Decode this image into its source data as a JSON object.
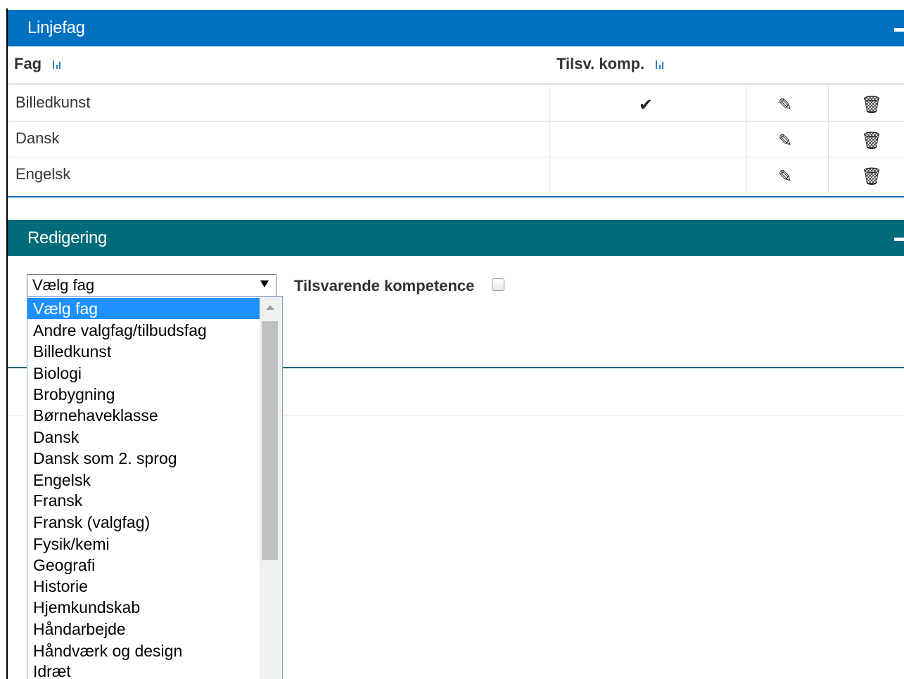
{
  "linjefag": {
    "title": "Linjefag",
    "col_fag": "Fag",
    "col_tilsv": "Tilsv. komp.",
    "rows": [
      {
        "fag": "Billedkunst",
        "tilsv": true
      },
      {
        "fag": "Dansk",
        "tilsv": false
      },
      {
        "fag": "Engelsk",
        "tilsv": false
      }
    ]
  },
  "redigering": {
    "title": "Redigering",
    "select_value": "Vælg fag",
    "checkbox_label": "Tilsvarende kompetence",
    "options": [
      "Vælg fag",
      "Andre valgfag/tilbudsfag",
      "Billedkunst",
      "Biologi",
      "Brobygning",
      "Børnehaveklasse",
      "Dansk",
      "Dansk som 2. sprog",
      "Engelsk",
      "Fransk",
      "Fransk (valgfag)",
      "Fysik/kemi",
      "Geografi",
      "Historie",
      "Hjemkundskab",
      "Håndarbejde",
      "Håndværk og design",
      "Idræt"
    ]
  },
  "icons": {
    "check": "check-icon",
    "edit": "pencil-icon",
    "delete": "trash-icon",
    "sort": "sort-icon",
    "collapse": "minus-icon"
  },
  "colors": {
    "linjefag_header": "#0070c0",
    "redigering_header": "#006b7a",
    "selected_option": "#1e90ff"
  }
}
